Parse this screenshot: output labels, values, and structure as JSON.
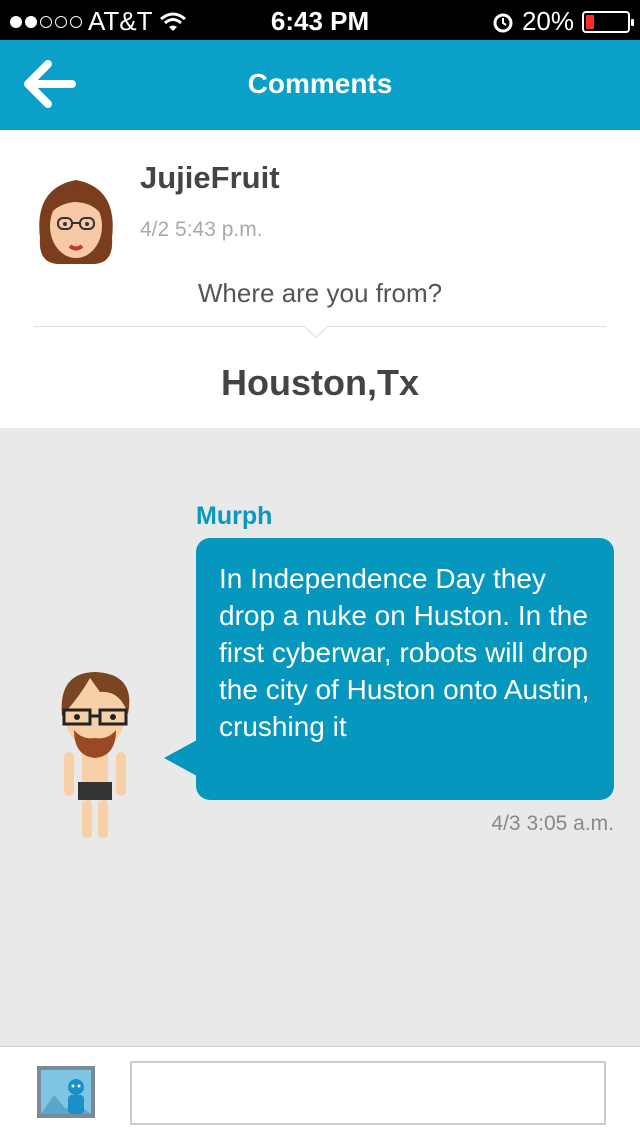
{
  "status_bar": {
    "carrier": "AT&T",
    "time": "6:43 PM",
    "battery": "20%",
    "battery_level": 0.2,
    "signal_bars_filled": 2
  },
  "header": {
    "title": "Comments"
  },
  "post": {
    "author": "JujieFruit",
    "time": "4/2 5:43 p.m.",
    "question": "Where are you from?",
    "answer": "Houston,Tx"
  },
  "comment": {
    "author": "Murph",
    "text": "In Independence Day they drop a nuke on Huston.  In the first cyberwar, robots will drop the city of Huston onto Austin, crushing it",
    "time": "4/3 3:05 a.m."
  },
  "compose": {
    "input_value": "",
    "placeholder": ""
  },
  "colors": {
    "accent": "#0ba0c7",
    "bubble": "#0597bd"
  }
}
